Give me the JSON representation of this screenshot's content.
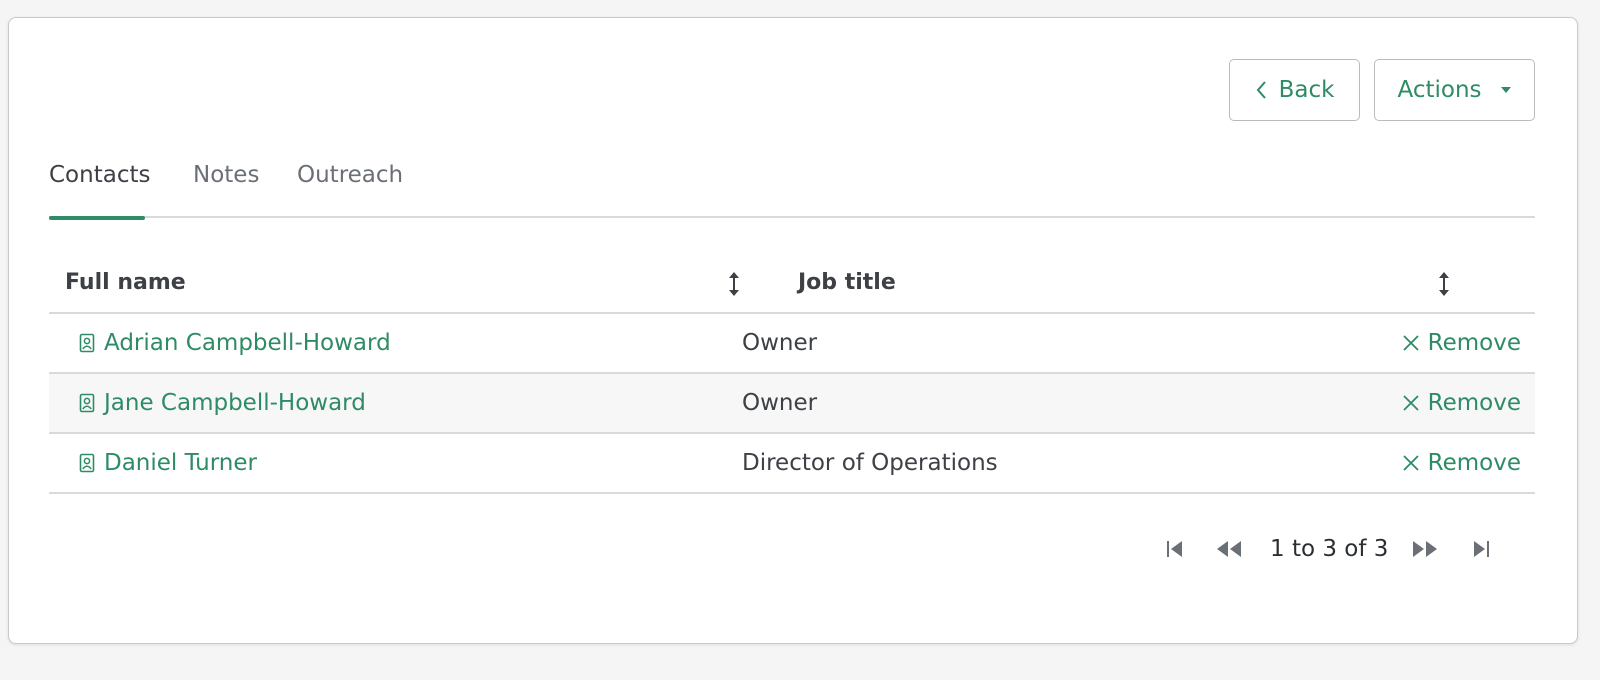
{
  "toolbar": {
    "back_label": "Back",
    "actions_label": "Actions"
  },
  "tabs": [
    {
      "label": "Contacts",
      "active": true
    },
    {
      "label": "Notes",
      "active": false
    },
    {
      "label": "Outreach",
      "active": false
    }
  ],
  "table": {
    "columns": [
      "Full name",
      "Job title"
    ],
    "rows": [
      {
        "name": "Adrian Campbell-Howard",
        "job_title": "Owner",
        "action": "Remove"
      },
      {
        "name": "Jane Campbell-Howard",
        "job_title": "Owner",
        "action": "Remove"
      },
      {
        "name": "Daniel Turner",
        "job_title": "Director of Operations",
        "action": "Remove"
      }
    ]
  },
  "pagination": {
    "status": "1 to 3 of 3"
  },
  "icons": {
    "back": "chevron-left-icon",
    "actions": "caret-down-icon",
    "sort": "sort-vertical-icon",
    "contact": "contact-card-icon",
    "remove": "close-icon",
    "first": "first-page-icon",
    "prev": "previous-page-icon",
    "next": "next-page-icon",
    "last": "last-page-icon"
  },
  "colors": {
    "accent": "#2e8b66",
    "text": "#3d4146",
    "muted": "#6b7076",
    "border": "#d8dadc"
  }
}
